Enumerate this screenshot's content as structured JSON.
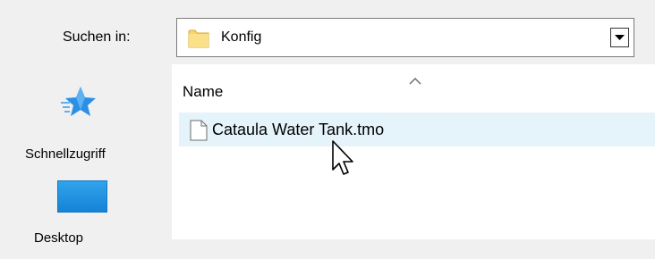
{
  "lookin": {
    "label": "Suchen in:",
    "value": "Konfig",
    "folder_icon": "folder-icon",
    "dropdown_icon": "dropdown-arrow-icon"
  },
  "places": {
    "items": [
      {
        "label": "Schnellzugriff",
        "icon": "star-icon"
      },
      {
        "label": "Desktop",
        "icon": "desktop-icon"
      }
    ]
  },
  "filelist": {
    "columns": [
      {
        "label": "Name",
        "sort": "ascending"
      }
    ],
    "files": [
      {
        "name": "Cataula Water Tank.tmo",
        "icon": "file-icon",
        "hovered": true
      }
    ]
  },
  "colors": {
    "background": "#f0f0f0",
    "hover_row": "#e5f3fb",
    "desktop_blue": "#1683d6",
    "star_blue": "#2b8fe6",
    "folder_yellow": "#f6d56a"
  }
}
